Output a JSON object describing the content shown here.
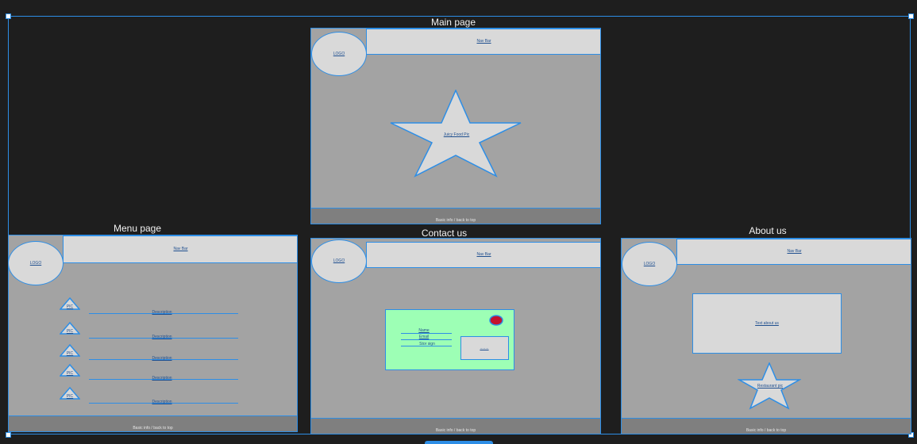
{
  "colors": {
    "canvas": "#1e1e1e",
    "selection": "#2d8ee6",
    "artboard_fill": "#a3a3a3",
    "element_fill": "#d9d9d9",
    "footer_fill": "#7f7f7f",
    "form_fill": "#9dffb5",
    "record_dot": "#c4122e"
  },
  "pages": {
    "main": {
      "title": "Main page",
      "logo": "LOGO",
      "navbar": "Nav Bar",
      "hero": "Juicy Food Pic",
      "footer": "Basic info / back to top"
    },
    "menu": {
      "title": "Menu page",
      "logo": "LOGO",
      "navbar": "Nav Bar",
      "footer": "Basic info / back to top",
      "items": [
        {
          "pic": "PIC",
          "description": "Description"
        },
        {
          "pic": "PIC",
          "description": "Description"
        },
        {
          "pic": "PIC",
          "description": "Description"
        },
        {
          "pic": "PIC",
          "description": "Description"
        },
        {
          "pic": "PIC",
          "description": "Description"
        }
      ]
    },
    "contact": {
      "title": "Contact us",
      "logo": "LOGO",
      "navbar": "Nav Bar",
      "footer": "Basic info / back to top",
      "form": {
        "name": "Name",
        "email": "Email",
        "extra": "Stor sign",
        "submit": "........"
      }
    },
    "about": {
      "title": "About us",
      "logo": "LOGO",
      "navbar": "Nav Bar",
      "text_box": "Text about us",
      "restaurant_pic": "Restaurant pic",
      "footer": "Basic info / back to top"
    }
  }
}
